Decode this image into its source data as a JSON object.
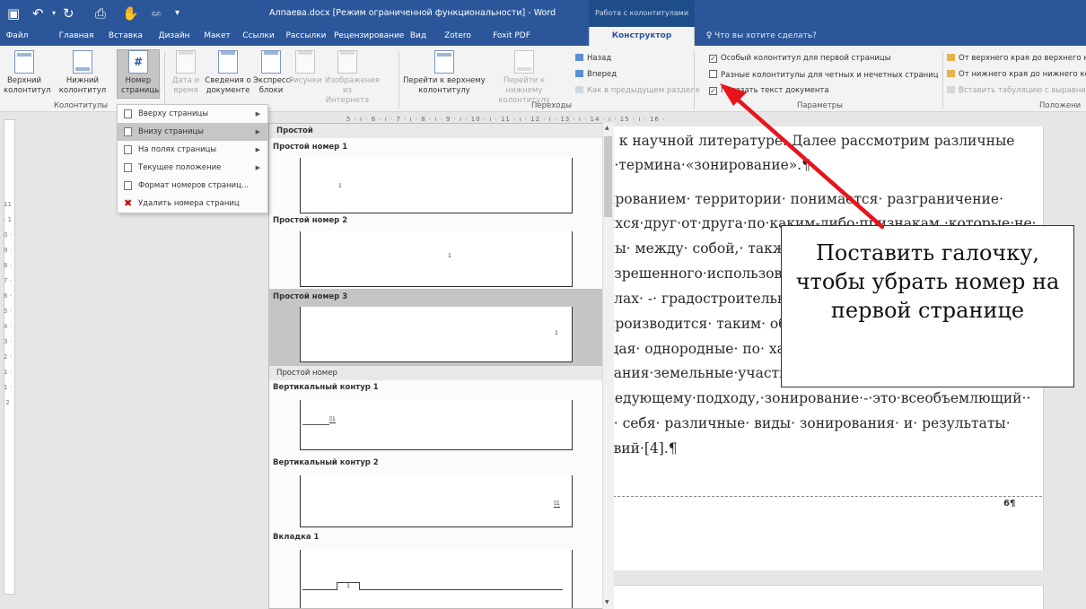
{
  "titlebar": {
    "save_icon": "save-icon",
    "undo_icon": "undo-icon",
    "redo_icon": "redo-icon",
    "doc_title": "Алпаева.docx [Режим ограниченной функциональности] - Word",
    "context_header": "Работа с колонтитулами"
  },
  "tabs": {
    "file": "Файл",
    "home": "Главная",
    "insert": "Вставка",
    "design": "Дизайн",
    "layout": "Макет",
    "references": "Ссылки",
    "mailings": "Рассылки",
    "review": "Рецензирование",
    "view": "Вид",
    "zotero": "Zotero",
    "foxit": "Foxit PDF",
    "designer": "Конструктор",
    "tellme": "Что вы хотите сделать?"
  },
  "ribbon": {
    "header_btn": "Верхний колонтитул",
    "footer_btn": "Нижний колонтитул",
    "page_number_btn": "Номер страницы",
    "group_headers": "Колонтитулы",
    "datetime_btn": "Дата и время",
    "docinfo_btn": "Сведения о документе",
    "quickparts_btn": "Экспресс-блоки",
    "pictures_btn": "Рисунки",
    "online_pictures_btn": "Изображения из Интернета",
    "group_insert": "Вставка",
    "goto_header_btn": "Перейти к верхнему колонтитулу",
    "goto_footer_btn": "Перейти к нижнему колонтитулу",
    "prev_btn": "Назад",
    "next_btn": "Вперед",
    "link_prev_btn": "Как в предыдущем разделе",
    "group_navigation": "Переходы",
    "opt_first_page": "Особый колонтитул для первой страницы",
    "opt_odd_even": "Разные колонтитулы для четных и нечетных страниц",
    "opt_show_text": "Показать текст документа",
    "group_options": "Параметры",
    "pos_header": "От верхнего края до верхнего к",
    "pos_footer": "От нижнего края до нижнего ко",
    "pos_tab": "Вставить табуляцию с выравни",
    "group_position": "Положени"
  },
  "menu": {
    "items": [
      {
        "label": "Вверху страницы"
      },
      {
        "label": "Внизу страницы"
      },
      {
        "label": "На полях страницы"
      },
      {
        "label": "Текущее положение"
      },
      {
        "label": "Формат номеров страниц..."
      },
      {
        "label": "Удалить номера страниц"
      }
    ]
  },
  "gallery": {
    "section1": "Простой",
    "items": [
      {
        "label": "Простой номер 1"
      },
      {
        "label": "Простой номер 2"
      },
      {
        "label": "Простой номер 3"
      }
    ],
    "section2": "Простой номер",
    "items2": [
      {
        "label": "Вертикальный контур 1"
      },
      {
        "label": "Вертикальный контур 2"
      },
      {
        "label": "Вкладка 1"
      }
    ]
  },
  "ruler": {
    "top": "5 · ı · 6 · ı · 7 · ı · 8 · ı · 9 · ı · 10 · ı · 11 · ı · 12 · ı · 13 · ı · 14 · ı · 15 · ı · 16 ·",
    "left": "11 · 10 · 9 · 8 · 7 · 6 · 5 · 4 · 3 · 2 · 1 · 1 · 2"
  },
  "document": {
    "lines": [
      "я к научной литературе. Далее рассмотрим различные",
      "о·термина·«зонирование».¶",
      "ированием· территории· понимается· разграничение·",
      "ихся·друг·от·друга·по·каким-либо·признакам,·которые·не·",
      "ны· между· собой,· также· зоны· с· особыми· условиями·",
      "азрешенного·использования·земельных·участков·и·т.д.",
      "елах· -· градостроительных· регламентов· и·",
      "производится· таким· образом,· чтобы· зоны·",
      "щая· однородные· по· характеру· использования·",
      "вания·земельные·участки·[3].¶",
      "ледующему·подходу,·зонирование·-·это·всеобъемлющий··",
      "в· себя· различные· виды· зонирования· и· результаты·",
      "твий·[4].¶"
    ],
    "page_number": "6¶"
  },
  "callout": {
    "text": "Поставить галочку, чтобы убрать номер на первой странице"
  }
}
